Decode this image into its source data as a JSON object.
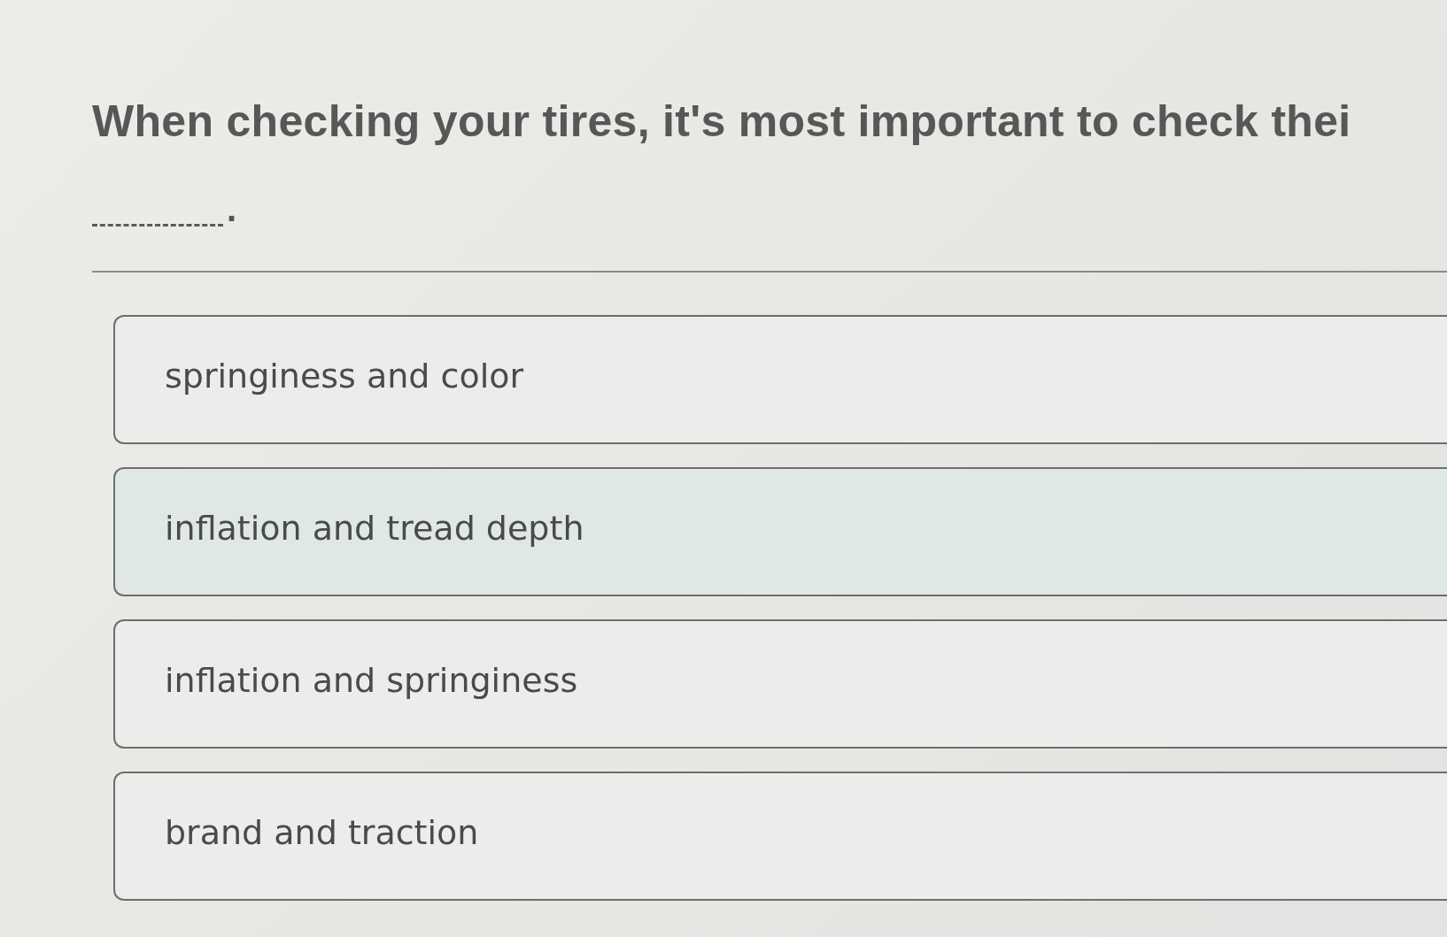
{
  "question": {
    "text": "When checking your tires, it's most important to check thei",
    "after_blank": "."
  },
  "options": [
    {
      "label": "springiness and color",
      "selected": false
    },
    {
      "label": "inflation and tread depth",
      "selected": true
    },
    {
      "label": "inflation and springiness",
      "selected": false
    },
    {
      "label": "brand and traction",
      "selected": false
    }
  ]
}
